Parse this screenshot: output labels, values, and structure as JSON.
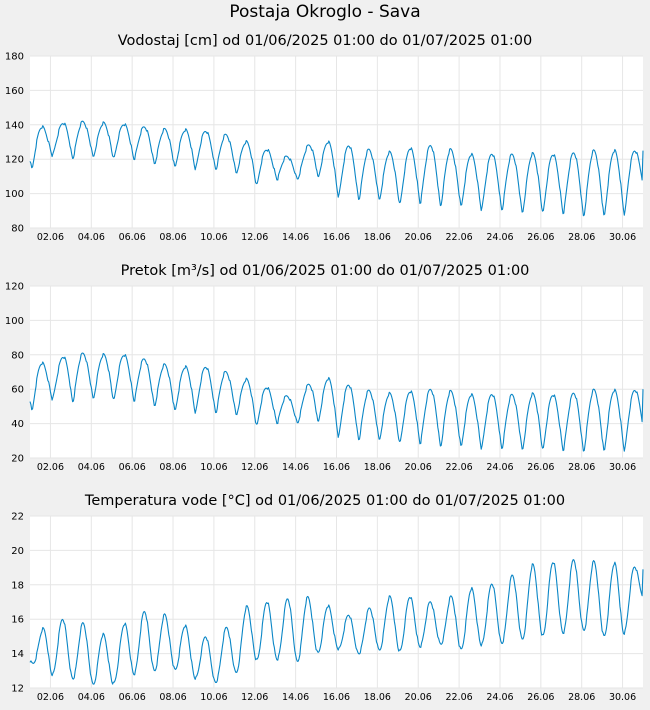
{
  "page_title": "Postaja Okroglo - Sava",
  "x_tick_labels": [
    "02.06",
    "04.06",
    "06.06",
    "08.06",
    "10.06",
    "12.06",
    "14.06",
    "16.06",
    "18.06",
    "20.06",
    "22.06",
    "24.06",
    "26.06",
    "28.06",
    "30.06"
  ],
  "line_color": "#0a86c6",
  "grid_color": "#e6e6e6",
  "chart_data": [
    {
      "type": "line",
      "title": "Vodostaj [cm] od 01/06/2025 01:00 do 01/07/2025 01:00",
      "xlabel": "",
      "ylabel": "",
      "x": [
        "01.06",
        "02.06",
        "03.06",
        "04.06",
        "05.06",
        "06.06",
        "07.06",
        "08.06",
        "09.06",
        "10.06",
        "11.06",
        "12.06",
        "13.06",
        "14.06",
        "15.06",
        "16.06",
        "17.06",
        "18.06",
        "19.06",
        "20.06",
        "21.06",
        "22.06",
        "23.06",
        "24.06",
        "25.06",
        "26.06",
        "27.06",
        "28.06",
        "29.06",
        "30.06",
        "01.07"
      ],
      "ylim": [
        80,
        180
      ],
      "yticks": [
        "80",
        "100",
        "120",
        "140",
        "160",
        "180"
      ],
      "series": [
        {
          "daily_max": [
            140,
            138,
            143,
            141,
            141,
            140,
            138,
            137,
            137,
            136,
            133,
            128,
            124,
            120,
            133,
            128,
            128,
            124,
            124,
            128,
            128,
            124,
            122,
            124,
            122,
            124,
            122,
            125,
            125,
            125,
            125
          ],
          "daily_min": [
            113,
            122,
            120,
            121,
            120,
            120,
            117,
            115,
            114,
            114,
            112,
            104,
            108,
            108,
            110,
            98,
            96,
            96,
            93,
            94,
            92,
            92,
            90,
            90,
            88,
            88,
            88,
            86,
            86,
            86,
            100
          ]
        }
      ]
    },
    {
      "type": "line",
      "title": "Pretok [m³/s] od 01/06/2025 01:00 do 01/07/2025 01:00",
      "xlabel": "",
      "ylabel": "",
      "x": [
        "01.06",
        "02.06",
        "03.06",
        "04.06",
        "05.06",
        "06.06",
        "07.06",
        "08.06",
        "09.06",
        "10.06",
        "11.06",
        "12.06",
        "13.06",
        "14.06",
        "15.06",
        "16.06",
        "17.06",
        "18.06",
        "19.06",
        "20.06",
        "21.06",
        "22.06",
        "23.06",
        "24.06",
        "25.06",
        "26.06",
        "27.06",
        "28.06",
        "29.06",
        "30.06",
        "01.07"
      ],
      "ylim": [
        20,
        120
      ],
      "yticks": [
        "20",
        "40",
        "60",
        "80",
        "100",
        "120"
      ],
      "series": [
        {
          "daily_max": [
            77,
            74,
            82,
            80,
            80,
            80,
            76,
            73,
            73,
            73,
            68,
            64,
            59,
            54,
            68,
            65,
            61,
            58,
            57,
            60,
            60,
            58,
            56,
            58,
            56,
            58,
            56,
            59,
            60,
            59,
            60
          ],
          "daily_min": [
            46,
            54,
            52,
            54,
            53,
            53,
            50,
            47,
            46,
            46,
            45,
            38,
            40,
            40,
            41,
            32,
            30,
            30,
            28,
            28,
            26,
            26,
            25,
            25,
            24,
            24,
            24,
            23,
            23,
            23,
            32
          ]
        }
      ]
    },
    {
      "type": "line",
      "title": "Temperatura vode [°C] od 01/06/2025 01:00 do 01/07/2025 01:00",
      "xlabel": "",
      "ylabel": "",
      "x": [
        "01.06",
        "02.06",
        "03.06",
        "04.06",
        "05.06",
        "06.06",
        "07.06",
        "08.06",
        "09.06",
        "10.06",
        "11.06",
        "12.06",
        "13.06",
        "14.06",
        "15.06",
        "16.06",
        "17.06",
        "18.06",
        "19.06",
        "20.06",
        "21.06",
        "22.06",
        "23.06",
        "24.06",
        "25.06",
        "26.06",
        "27.06",
        "28.06",
        "29.06",
        "30.06",
        "01.07"
      ],
      "ylim": [
        12,
        22
      ],
      "yticks": [
        "12",
        "14",
        "16",
        "18",
        "20",
        "22"
      ],
      "series": [
        {
          "daily_max": [
            14.2,
            16.2,
            15.9,
            15.7,
            14.7,
            16.4,
            16.5,
            16.1,
            15.3,
            14.8,
            16.0,
            17.2,
            16.9,
            17.4,
            17.2,
            16.5,
            16.1,
            17.0,
            17.5,
            17.2,
            16.9,
            17.6,
            17.9,
            18.2,
            18.8,
            19.4,
            19.3,
            19.6,
            19.2,
            19.3,
            18.9
          ],
          "daily_min": [
            13.5,
            12.8,
            12.6,
            12.2,
            12.2,
            12.8,
            13.0,
            13.1,
            12.6,
            12.3,
            12.8,
            13.6,
            13.7,
            13.5,
            14.0,
            14.3,
            14.0,
            14.2,
            14.1,
            14.4,
            14.6,
            14.2,
            14.5,
            14.6,
            14.8,
            15.0,
            15.2,
            15.4,
            15.0,
            15.0,
            17.2
          ]
        }
      ]
    }
  ]
}
